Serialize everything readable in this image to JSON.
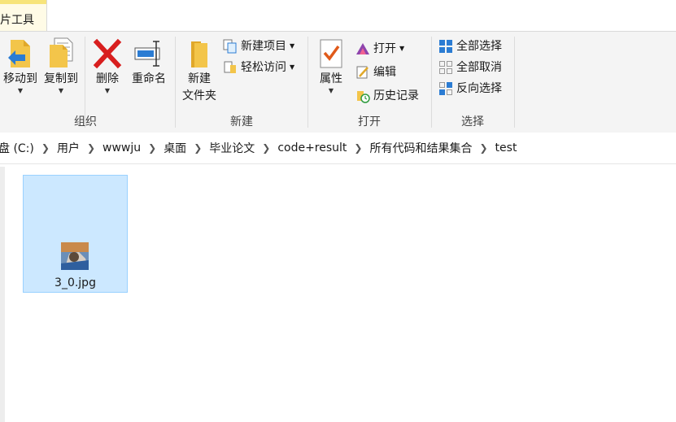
{
  "tabs": {
    "contextual_tab": "片工具"
  },
  "ribbon": {
    "organize": {
      "group_label": "组织",
      "move_to": "移动到",
      "copy_to": "复制到",
      "delete": "删除",
      "rename": "重命名"
    },
    "new": {
      "group_label": "新建",
      "new_folder_line1": "新建",
      "new_folder_line2": "文件夹",
      "new_item": "新建项目",
      "easy_access": "轻松访问"
    },
    "open": {
      "group_label": "打开",
      "properties": "属性",
      "open": "打开",
      "edit": "编辑",
      "history": "历史记录"
    },
    "select": {
      "group_label": "选择",
      "select_all": "全部选择",
      "select_none": "全部取消",
      "invert_selection": "反向选择"
    }
  },
  "address": {
    "crumbs": [
      "盘 (C:)",
      "用户",
      "wwwju",
      "桌面",
      "毕业论文",
      "code+result",
      "所有代码和结果集合",
      "test"
    ]
  },
  "files": [
    {
      "name": "3_0.jpg",
      "selected": true
    }
  ],
  "colors": {
    "ribbon_bg": "#f4f4f4",
    "selection_bg": "#cce8ff",
    "selection_border": "#99d1ff",
    "delete_red": "#d81e1e",
    "folder_yellow": "#f3c54a",
    "accent_blue": "#2b7cd3"
  }
}
